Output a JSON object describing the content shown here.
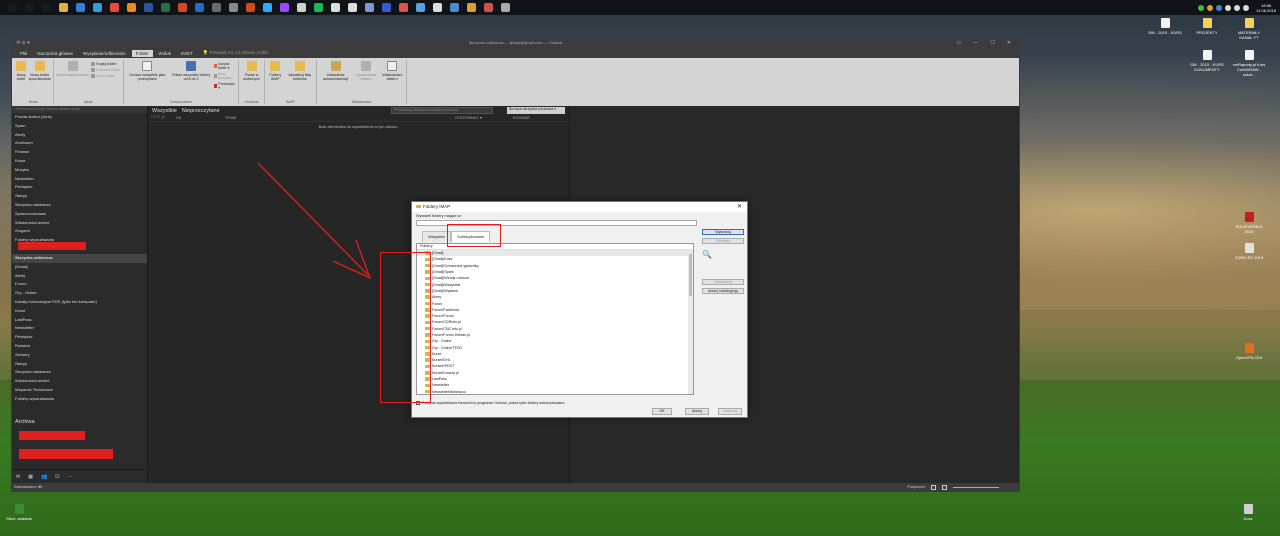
{
  "taskbar": {
    "clock_time": "18:56",
    "clock_date": "11.06.2018",
    "icons": [
      "start-icon",
      "search-icon",
      "task-view-icon",
      "explorer-icon",
      "store-icon",
      "edge-icon",
      "chrome-icon",
      "firefox-icon",
      "word-icon",
      "excel-icon",
      "powerpoint-icon",
      "outlook-icon",
      "app-icon",
      "app-icon",
      "app-icon",
      "photoshop-icon",
      "premiere-icon",
      "app-icon",
      "spotify-icon",
      "app-icon",
      "app-icon",
      "app-icon",
      "app-icon",
      "app-icon",
      "app-icon",
      "app-icon",
      "app-icon",
      "app-icon",
      "app-icon",
      "app-icon"
    ],
    "icon_colors": [
      "#1a1a1a",
      "#1a1a1a",
      "#1a1a1a",
      "#e2b33a",
      "#3a7bd5",
      "#3a9ad9",
      "#e84a3a",
      "#f08a1e",
      "#2b579a",
      "#217346",
      "#d24726",
      "#1e6fbf",
      "#6a6a6a",
      "#888",
      "#d04a1a",
      "#31a8ff",
      "#9a4aff",
      "#d0d0d0",
      "#1db954",
      "#ddd",
      "#ddd",
      "#7a9ad0",
      "#3a5ad0",
      "#e05050",
      "#5aa0e0",
      "#ddd",
      "#4a8ad0",
      "#e0a030",
      "#d05050",
      "#aaa"
    ]
  },
  "desktop_icons": [
    {
      "label": "SW - 2015 - KURS",
      "color": "#f2f2f2"
    },
    {
      "label": "PROJEKTY",
      "color": "#f2d060"
    },
    {
      "label": "MATERIAŁY KANAŁ YT",
      "color": "#f2d060"
    },
    {
      "label": "SW - 2015 - KURS DOKUMENTY",
      "color": "#f2f2f2"
    },
    {
      "label": "zmRaporty.pl Kurs CorelDRAW - szkol...",
      "color": "#f2f2f2"
    },
    {
      "label": "SOLIDWORKS 2015",
      "color": "#c02020"
    },
    {
      "label": "XONG.EX 2015",
      "color": "#e0e0e0"
    },
    {
      "label": "OpenVPN GUI",
      "color": "#e07020"
    },
    {
      "label": "Sieci: zasłania",
      "color": "#3a8a3a"
    },
    {
      "label": "Kosz",
      "color": "#cfcfcf"
    }
  ],
  "outlook": {
    "qat": "⟲  ⊙  ▾",
    "title": "Skrzynka odbiorcza — ijbmpl@gmail.com — Outlook",
    "window_controls": [
      "▭",
      "—",
      "☐",
      "✕"
    ],
    "tabs": [
      "Plik",
      "Narzędzia główne",
      "Wysyłanie/odbieranie",
      "Folder",
      "Widok",
      "ESET"
    ],
    "active_tab": "Folder",
    "tell_me": "Powiedz mi, co chcesz zrobić",
    "ribbon": {
      "groups": [
        {
          "label": "Nowe",
          "buttons": [
            "Nowy folder",
            "Nowy folder wyszukiwania"
          ]
        },
        {
          "label": "Akcje",
          "buttons": [
            "Zmień nazwę folderu"
          ],
          "small": [
            "Kopiuj folder",
            "Przenieś folder",
            "Usuń folder"
          ]
        },
        {
          "label": "Oczyszczanie",
          "buttons": [
            "Oznacz wszystkie jako przeczytane",
            "Pokaż wszystkie foldery od A do Z"
          ],
          "small": [
            "Oczyść folder ▾",
            "Usuń wszystko",
            "Przeczyść ▾"
          ]
        },
        {
          "label": "Ulubione",
          "buttons": [
            "Pokaż w ulubionych"
          ]
        },
        {
          "label": "IMAP",
          "buttons": [
            "Foldery IMAP",
            "Aktualizuj listę folderów"
          ]
        },
        {
          "label": "Właściwości",
          "buttons": [
            "Ustawienia autoarchiwizacji",
            "Uprawnienia folderu",
            "Właściwości folderu"
          ]
        }
      ]
    },
    "nav": {
      "search": "Przeszukaj Swoje Foldery ostatnio kupy",
      "items": [
        "Poczta śmieci (Junk)",
        "Spam",
        "Alerty",
        "Archiwum",
        "Finanse",
        "Kurse",
        "Muzyka",
        "Newsletter",
        "Pieniądze",
        "Sklepy",
        "Skrzynka nadawcza",
        "Społecznościowe",
        "Wiadomości-śmieci",
        "Zrogami",
        "Foldery wyszukiwania"
      ],
      "account2_items": [
        "Skrzynka odbiorcza",
        "[Gmail]",
        "Alerty",
        "Forum",
        "Gry - Online",
        "Kanały informacyjne RSS (tylko ten komputer)",
        "Kurse",
        "LastPass",
        "Newsletter",
        "Pieniądze",
        "Rodzina",
        "Serwery",
        "Sklepy",
        "Skrzynka nadawcza",
        "Wiadomości-śmieci",
        "Wsparcie Techniczne",
        "Foldery wyszukiwania"
      ],
      "archive": "Archiwa",
      "bottom_icons": [
        "✉",
        "▦",
        "👥",
        "☑",
        "···"
      ]
    },
    "list": {
      "filter_all": "Wszystkie",
      "filter_unread": "Nieprzeczytane",
      "search_placeholder": "Przeszukaj: Bieżąca skrzynka pocztowa",
      "scope": "Bieżąca skrzynka pocztowa ▾",
      "col_icons": "! ☐ ✎ 🖉",
      "col_from": "OD",
      "col_subject": "TEMAT",
      "col_received": "OTRZYMANO ▼",
      "col_size": "ROZMIAR",
      "empty_msg": "Brak elementów do wyświetlenia w tym widoku."
    },
    "status": {
      "left": "Zastosowano filtr",
      "right": "Połączono"
    }
  },
  "dialog": {
    "title": "Foldery IMAP",
    "close": "✕",
    "show_label": "Wyświetl foldery mające w:",
    "tabs": [
      "Wszystkie",
      "Subskrybowane"
    ],
    "active_tab": "Subskrybowane",
    "list_header": "Foldery",
    "folders": [
      "[Gmail]",
      "[Gmail]/Kosz",
      "[Gmail]/Oznaczone gwiazdką",
      "[Gmail]/Spam",
      "[Gmail]/Wersje robocze",
      "[Gmail]/Wszystkie",
      "[Gmail]/Wysłane",
      "Alerty",
      "Forum",
      "Forum/Facebook",
      "Forum/Forum",
      "Forum/CDRinfo.pl",
      "Forum/CNC.info.pl",
      "Forum/Forum Debian.pl",
      "Gry - Online",
      "Gry - Online/TESO",
      "Kurse",
      "Kurse/IDHL",
      "Kurse/KPDST",
      "Kurse/Kurserp.pl",
      "LastPass",
      "Newsletter",
      "Newsletter/Itahanpco",
      "Newsletter/Sklepy"
    ],
    "buttons": [
      "Wyszukaj",
      "Zmniejsz",
      "Subskrybuj",
      "Anuluj subskrypcję"
    ],
    "checkbox": "Podczas wyświetlania hierarchii w programie Outlook, pokaż tylko foldery subskrybowane.",
    "ok": "OK",
    "cancel": "Anuluj",
    "apply": "Zastosuj"
  }
}
